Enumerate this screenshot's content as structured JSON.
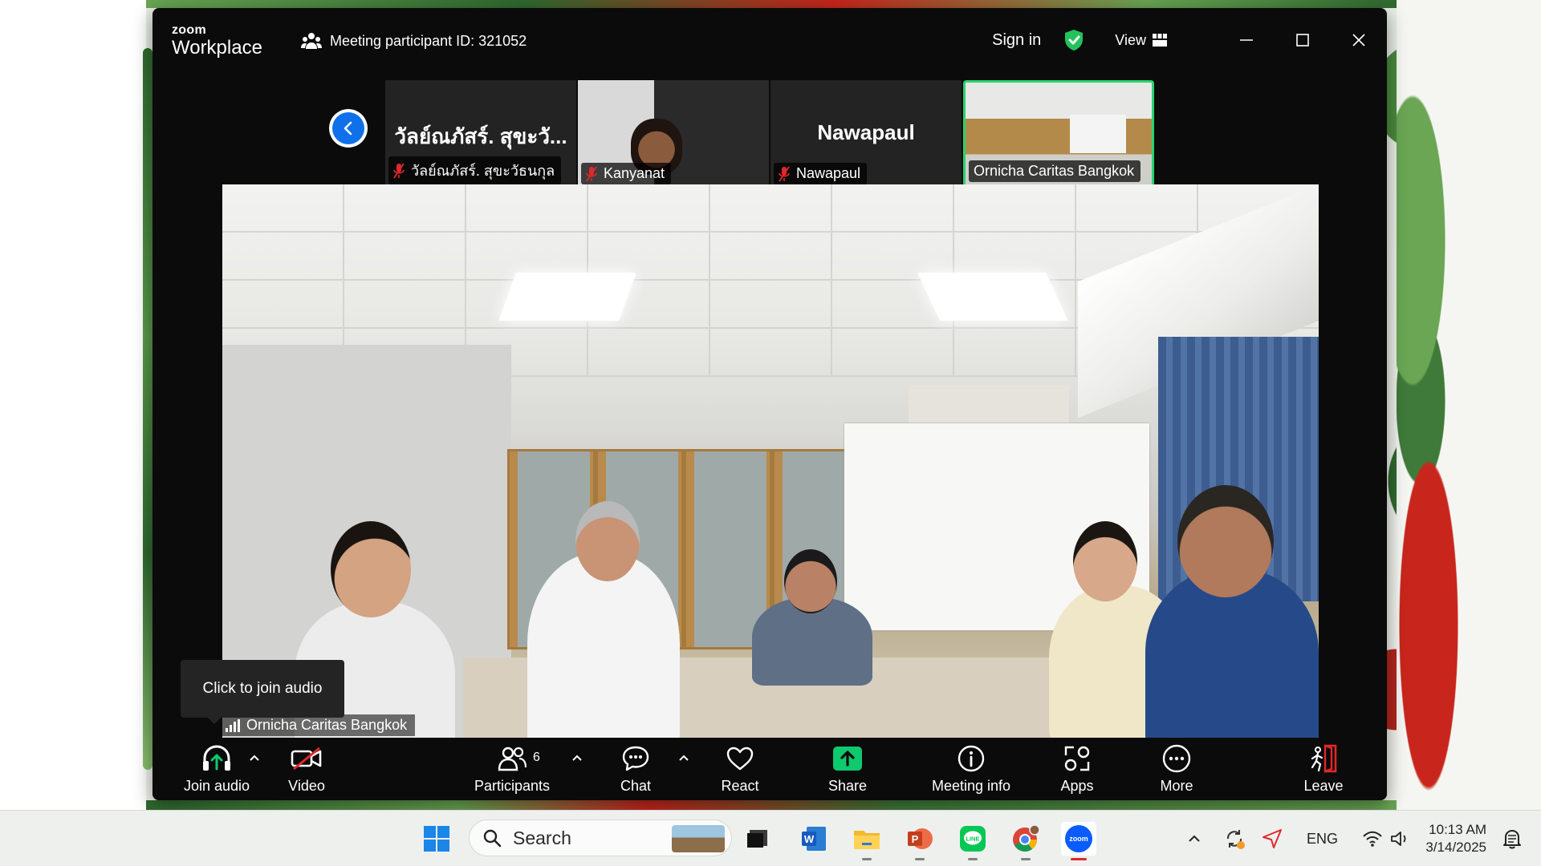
{
  "window": {
    "brand_top": "zoom",
    "brand_bottom": "Workplace",
    "meeting_id_text": "Meeting participant ID: 321052",
    "sign_in": "Sign in",
    "view": "View"
  },
  "thumbnails": [
    {
      "title": "วัลย์ณภัสร์. สุขะวั...",
      "name": "วัลย์ณภัสร์. สุขะวัธนกุล",
      "muted": true
    },
    {
      "title": "",
      "name": "Kanyanat",
      "muted": true
    },
    {
      "title": "Nawapaul",
      "name": "Nawapaul",
      "muted": true
    },
    {
      "title": "",
      "name": "Ornicha Caritas Bangkok",
      "muted": false,
      "active": true
    }
  ],
  "main_video": {
    "speaker_label": "Ornicha Caritas Bangkok"
  },
  "tooltip": "Click to join audio",
  "toolbar": {
    "join_audio": "Join audio",
    "video": "Video",
    "participants": "Participants",
    "participants_count": "6",
    "chat": "Chat",
    "react": "React",
    "share": "Share",
    "meeting_info": "Meeting info",
    "apps": "Apps",
    "more": "More",
    "leave": "Leave"
  },
  "colors": {
    "share_green": "#0ec96d",
    "active_border": "#2bd46e",
    "zoom_blue": "#0e71eb",
    "leave_red": "#e0282c",
    "shield_green": "#23c35c"
  },
  "taskbar": {
    "search_placeholder": "Search",
    "language": "ENG",
    "time": "10:13 AM",
    "date": "3/14/2025"
  }
}
